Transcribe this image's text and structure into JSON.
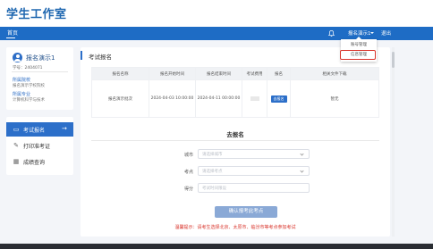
{
  "app": {
    "title": "学生工作室"
  },
  "nav": {
    "home": "首页",
    "user_menu": "报名演示1",
    "logout": "退出",
    "dropdown": [
      "账号管理",
      "信息管理"
    ]
  },
  "profile": {
    "name": "报名演示1",
    "student_id": "学号：2404071",
    "college_label": "所属院校",
    "college_value": "报名演示学校院校",
    "major_label": "所属专业",
    "major_value": "计算机科学与技术"
  },
  "menu": [
    {
      "label": "考试报名",
      "icon": "▭",
      "active": true
    },
    {
      "label": "打印准考证",
      "icon": "✎",
      "active": false
    },
    {
      "label": "成绩查询",
      "icon": "▦",
      "active": false
    }
  ],
  "main": {
    "title": "考试报名",
    "table": {
      "headers": [
        "报名名称",
        "报名开始时间",
        "报名结束时间",
        "考试费用",
        "报名",
        "相关文件下载"
      ],
      "row": {
        "name": "报名演示批次",
        "start": "2024-04-03 10:00:00",
        "end": "2024-04-11 00:00:00",
        "action": "去报名",
        "files": "暂无"
      }
    },
    "form": {
      "title": "去报名",
      "city_label": "城市",
      "city_placeholder": "请选择城市",
      "site_label": "考点",
      "site_placeholder": "请选择考点",
      "score_label": "得分",
      "score_placeholder": "考试时间限设",
      "confirm": "确认报考此考点",
      "notice": "温馨提示：请考生选择北京、太原市、临汾市等考点参加考试"
    }
  },
  "colors": {
    "brand": "#1f67b0",
    "nav": "#1e6cc5",
    "accent": "#2c6fc9",
    "alert": "#d9342b"
  }
}
